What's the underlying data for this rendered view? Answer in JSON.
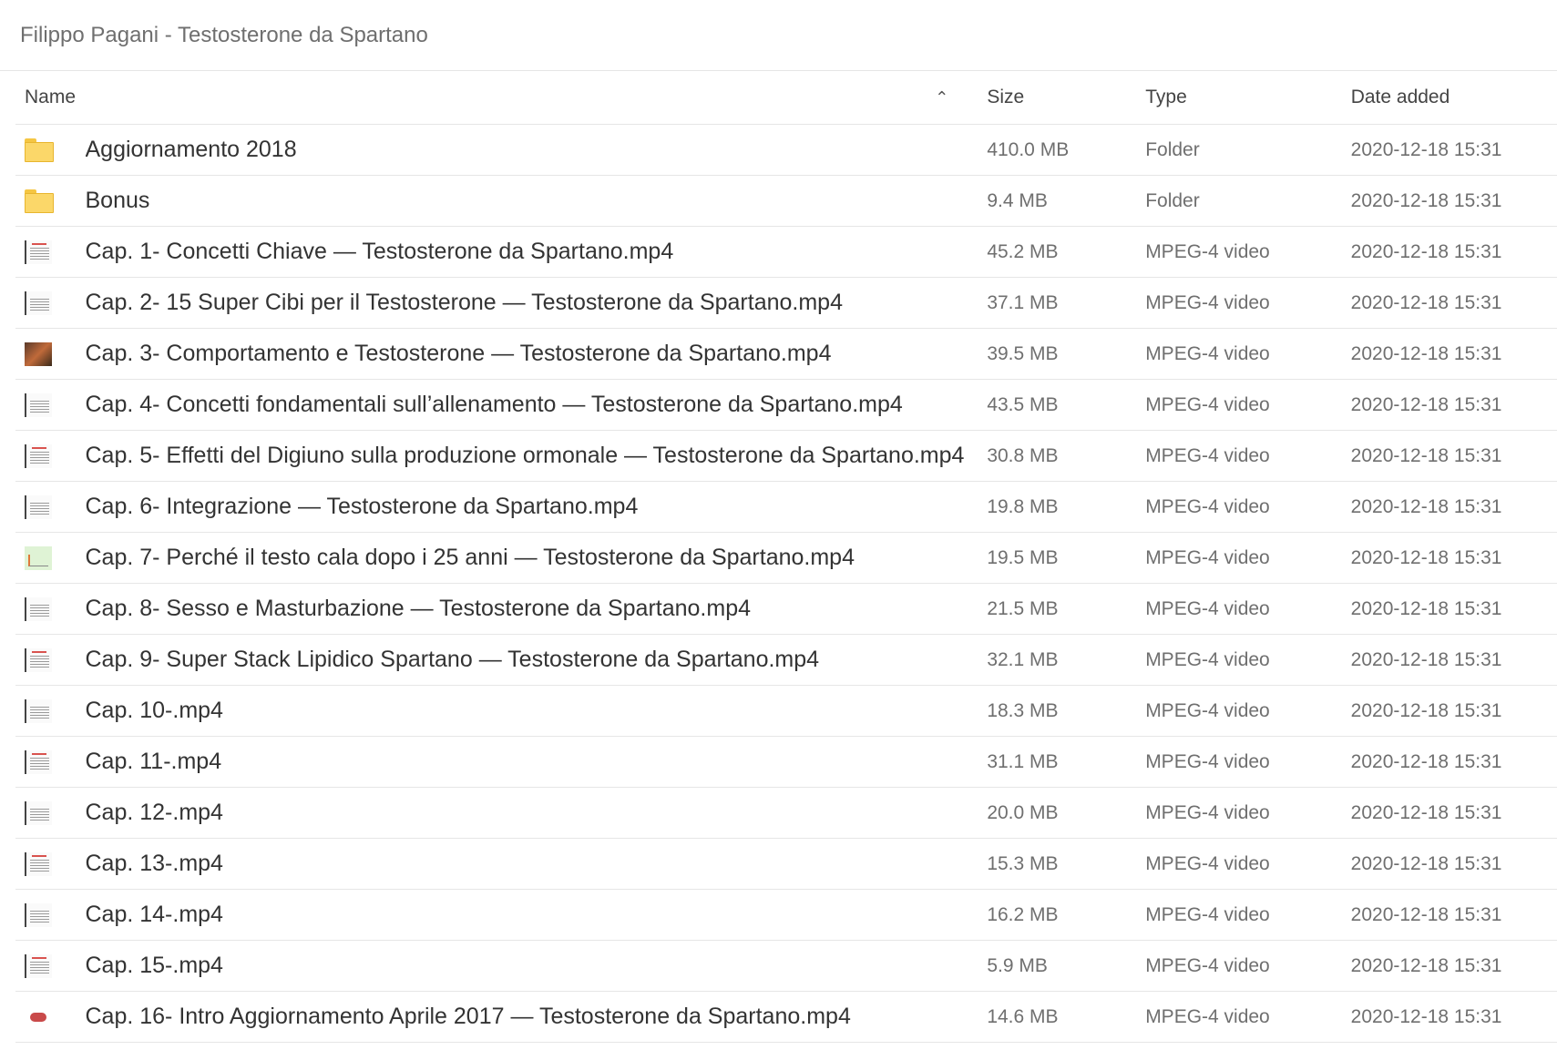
{
  "breadcrumb": "Filippo Pagani - Testosterone da Spartano",
  "columns": {
    "name": "Name",
    "size": "Size",
    "type": "Type",
    "date": "Date added",
    "sort_icon": "chevron-up-icon"
  },
  "rows": [
    {
      "icon": "folder-icon",
      "name": "Aggiornamento 2018",
      "size": "410.0 MB",
      "type": "Folder",
      "date": "2020-12-18 15:31"
    },
    {
      "icon": "folder-icon",
      "name": "Bonus",
      "size": "9.4 MB",
      "type": "Folder",
      "date": "2020-12-18 15:31"
    },
    {
      "icon": "video-thumbnail-icon",
      "name": "Cap. 1- Concetti Chiave — Testosterone da Spartano.mp4",
      "size": "45.2 MB",
      "type": "MPEG-4 video",
      "date": "2020-12-18 15:31"
    },
    {
      "icon": "video-thumbnail-icon",
      "name": "Cap. 2- 15 Super Cibi per il Testosterone — Testosterone da Spartano.mp4",
      "size": "37.1 MB",
      "type": "MPEG-4 video",
      "date": "2020-12-18 15:31"
    },
    {
      "icon": "video-thumbnail-icon",
      "name": "Cap. 3- Comportamento e Testosterone — Testosterone da Spartano.mp4",
      "size": "39.5 MB",
      "type": "MPEG-4 video",
      "date": "2020-12-18 15:31"
    },
    {
      "icon": "video-thumbnail-icon",
      "name": "Cap. 4- Concetti fondamentali sull’allenamento — Testosterone da Spartano.mp4",
      "size": "43.5 MB",
      "type": "MPEG-4 video",
      "date": "2020-12-18 15:31"
    },
    {
      "icon": "video-thumbnail-icon",
      "name": "Cap. 5- Effetti del Digiuno sulla produzione ormonale — Testosterone da Spartano.mp4",
      "size": "30.8 MB",
      "type": "MPEG-4 video",
      "date": "2020-12-18 15:31"
    },
    {
      "icon": "video-thumbnail-icon",
      "name": "Cap. 6- Integrazione — Testosterone da Spartano.mp4",
      "size": "19.8 MB",
      "type": "MPEG-4 video",
      "date": "2020-12-18 15:31"
    },
    {
      "icon": "video-thumbnail-icon",
      "name": "Cap. 7- Perché il testo cala dopo i 25 anni — Testosterone da Spartano.mp4",
      "size": "19.5 MB",
      "type": "MPEG-4 video",
      "date": "2020-12-18 15:31"
    },
    {
      "icon": "video-thumbnail-icon",
      "name": "Cap. 8- Sesso e Masturbazione — Testosterone da Spartano.mp4",
      "size": "21.5 MB",
      "type": "MPEG-4 video",
      "date": "2020-12-18 15:31"
    },
    {
      "icon": "video-thumbnail-icon",
      "name": "Cap. 9- Super Stack Lipidico Spartano — Testosterone da Spartano.mp4",
      "size": "32.1 MB",
      "type": "MPEG-4 video",
      "date": "2020-12-18 15:31"
    },
    {
      "icon": "video-thumbnail-icon",
      "name": "Cap. 10-.mp4",
      "size": "18.3 MB",
      "type": "MPEG-4 video",
      "date": "2020-12-18 15:31"
    },
    {
      "icon": "video-thumbnail-icon",
      "name": "Cap. 11-.mp4",
      "size": "31.1 MB",
      "type": "MPEG-4 video",
      "date": "2020-12-18 15:31"
    },
    {
      "icon": "video-thumbnail-icon",
      "name": "Cap. 12-.mp4",
      "size": "20.0 MB",
      "type": "MPEG-4 video",
      "date": "2020-12-18 15:31"
    },
    {
      "icon": "video-thumbnail-icon",
      "name": "Cap. 13-.mp4",
      "size": "15.3 MB",
      "type": "MPEG-4 video",
      "date": "2020-12-18 15:31"
    },
    {
      "icon": "video-thumbnail-icon",
      "name": "Cap. 14-.mp4",
      "size": "16.2 MB",
      "type": "MPEG-4 video",
      "date": "2020-12-18 15:31"
    },
    {
      "icon": "video-thumbnail-icon",
      "name": "Cap. 15-.mp4",
      "size": "5.9 MB",
      "type": "MPEG-4 video",
      "date": "2020-12-18 15:31"
    },
    {
      "icon": "video-thumbnail-icon",
      "name": "Cap. 16- Intro Aggiornamento Aprile 2017 — Testosterone da Spartano.mp4",
      "size": "14.6 MB",
      "type": "MPEG-4 video",
      "date": "2020-12-18 15:31"
    }
  ]
}
